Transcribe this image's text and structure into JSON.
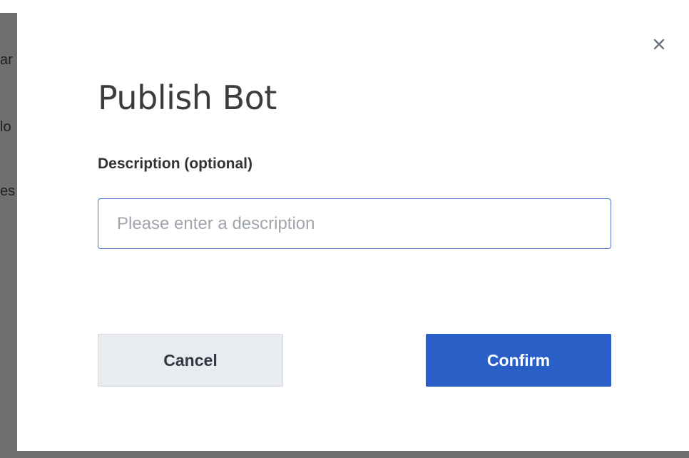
{
  "backdrop": {
    "fragments": [
      "ar",
      "lo",
      "es"
    ]
  },
  "modal": {
    "title": "Publish Bot",
    "close_icon": "close-icon",
    "description_label": "Description (optional)",
    "description_value": "",
    "description_placeholder": "Please enter a description",
    "cancel_label": "Cancel",
    "confirm_label": "Confirm"
  },
  "colors": {
    "accent": "#2a5fc8",
    "input_border": "#4a72c9",
    "cancel_bg": "#e8ebf0",
    "overlay": "#6f6f6f"
  }
}
